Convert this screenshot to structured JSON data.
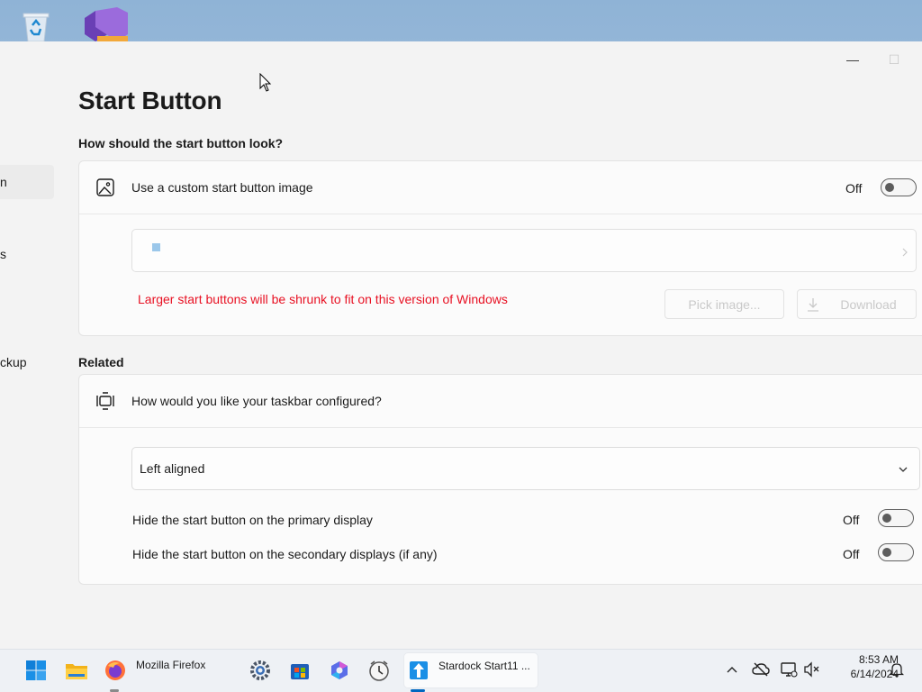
{
  "window": {
    "minimize_glyph": "—",
    "maximize_glyph": "☐"
  },
  "nav": {
    "fragment_1": "n",
    "fragment_2": "s",
    "fragment_3": "ckup"
  },
  "page": {
    "title": "Start Button",
    "look_section_label": "How should the start button look?",
    "related_section_label": "Related"
  },
  "custom_image": {
    "label": "Use a custom start button image",
    "toggle_state": "Off",
    "warning": "Larger start buttons will be shrunk to fit on this version of Windows",
    "pick_image_label": "Pick image...",
    "download_label": "Download"
  },
  "taskbar_config": {
    "question": "How would you like your taskbar configured?",
    "alignment_value": "Left aligned",
    "hide_primary_label": "Hide the start button on the primary display",
    "hide_primary_state": "Off",
    "hide_secondary_label": "Hide the start button on the secondary displays (if any)",
    "hide_secondary_state": "Off"
  },
  "taskbar": {
    "firefox_label": "Mozilla Firefox",
    "start11_label": "Stardock Start11 ...",
    "clock_time": "8:53 AM",
    "clock_date": "6/14/2024"
  },
  "colors": {
    "accent": "#0067c0",
    "warning": "#e81123"
  },
  "icons": {
    "desktop": [
      "recycle-bin-icon",
      "visual-studio-pdf-icon"
    ],
    "taskbar": [
      "windows-start-icon",
      "file-explorer-icon",
      "firefox-icon",
      "settings-icon",
      "microsoft-store-icon",
      "copilot-icon",
      "clock-app-icon",
      "start11-icon"
    ],
    "tray": [
      "chevron-up-icon",
      "cloud-off-icon",
      "network-icon",
      "volume-muted-icon",
      "notification-bell-icon"
    ]
  }
}
